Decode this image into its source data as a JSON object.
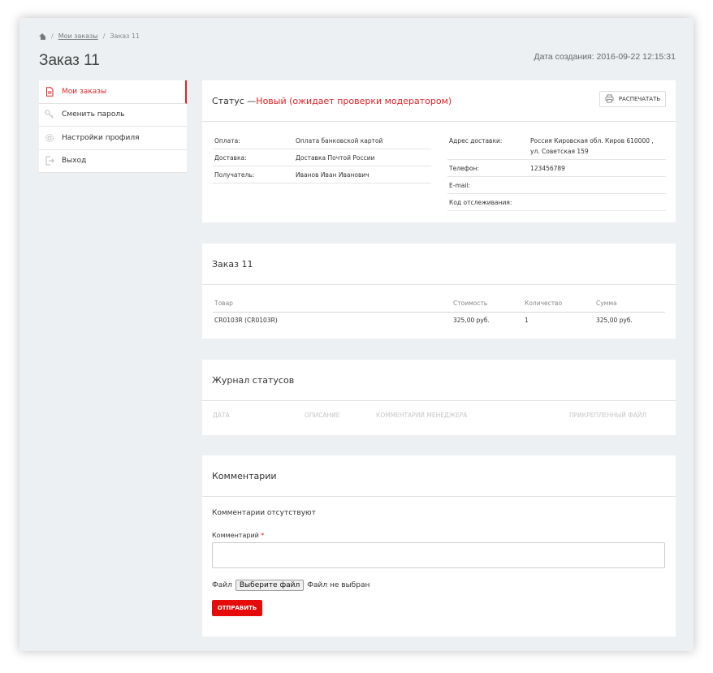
{
  "breadcrumb": {
    "link": "Мои заказы",
    "current": "Заказ 11"
  },
  "page": {
    "title": "Заказ 11",
    "created": "Дата создания: 2016-09-22 12:15:31"
  },
  "sidebar": {
    "items": [
      {
        "label": "Мои заказы",
        "icon": "document-icon"
      },
      {
        "label": "Сменить пароль",
        "icon": "key-icon"
      },
      {
        "label": "Настройки профиля",
        "icon": "gear-icon"
      },
      {
        "label": "Выход",
        "icon": "logout-icon"
      }
    ]
  },
  "status": {
    "prefix": "Статус — ",
    "value": "Новый (ожидает проверки модератором)",
    "print_label": "РАСПЕЧАТАТЬ",
    "left": [
      {
        "k": "Оплата:",
        "v": "Оплата банковской картой"
      },
      {
        "k": "Доставка:",
        "v": "Доставка Почтой России"
      },
      {
        "k": "Получатель:",
        "v": "Иванов Иван Иванович"
      }
    ],
    "right": [
      {
        "k": "Адрес доставки:",
        "v": "Россия Кировская обл. Киров 610000 , ул. Советская 159"
      },
      {
        "k": "Телефон:",
        "v": "123456789"
      },
      {
        "k": "E-mail:",
        "v": ""
      },
      {
        "k": "Код отслеживания:",
        "v": ""
      }
    ]
  },
  "order": {
    "title": "Заказ 11",
    "headers": [
      "Товар",
      "Стоимость",
      "Количество",
      "Сумма"
    ],
    "rows": [
      [
        "CR0103R (CR0103R)",
        "325,00 руб.",
        "1",
        "325,00 руб."
      ]
    ]
  },
  "log": {
    "title": "Журнал статусов",
    "headers": [
      "Дата",
      "Описание",
      "Комментарий менеджера",
      "Прикрепленный файл"
    ]
  },
  "comments": {
    "title": "Комментарии",
    "empty": "Комментарии отсутствуют",
    "label": "Комментарий",
    "required_mark": "*",
    "file_label": "Файл",
    "file_button": "Выберите файл",
    "file_status": "Файл не выбран",
    "submit": "ОТПРАВИТЬ"
  },
  "colors": {
    "accent": "#e32227",
    "button": "#e50b0b",
    "background": "#ecf0f2"
  }
}
